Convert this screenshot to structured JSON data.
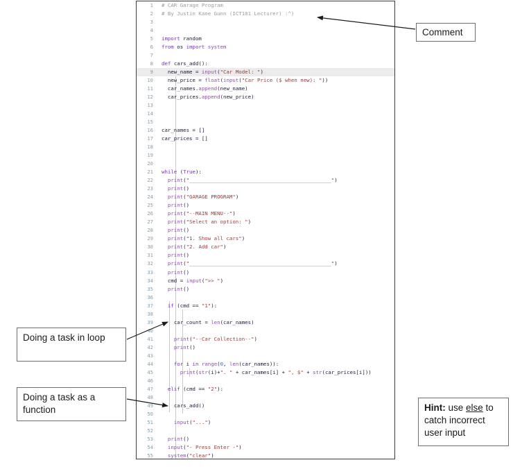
{
  "editor": {
    "name": "python-code-editor",
    "language": "Python",
    "current_line": 9,
    "lines": [
      {
        "n": 1,
        "text": "# CAR Garage Program"
      },
      {
        "n": 2,
        "text": "# By Justin Kane Gunn (ICT101 Lecturer) :^)"
      },
      {
        "n": 3,
        "text": ""
      },
      {
        "n": 4,
        "text": ""
      },
      {
        "n": 5,
        "text": "import random"
      },
      {
        "n": 6,
        "text": "from os import system"
      },
      {
        "n": 7,
        "text": ""
      },
      {
        "n": 8,
        "text": "def cars_add():"
      },
      {
        "n": 9,
        "text": "  new_name = input(\"Car Model: \")"
      },
      {
        "n": 10,
        "text": "  new_price = float(input(\"Car Price ($ when new): \"))"
      },
      {
        "n": 11,
        "text": "  car_names.append(new_name)"
      },
      {
        "n": 12,
        "text": "  car_prices.append(new_price)"
      },
      {
        "n": 13,
        "text": ""
      },
      {
        "n": 14,
        "text": ""
      },
      {
        "n": 15,
        "text": ""
      },
      {
        "n": 16,
        "text": "car_names = []"
      },
      {
        "n": 17,
        "text": "car_prices = []"
      },
      {
        "n": 18,
        "text": ""
      },
      {
        "n": 19,
        "text": ""
      },
      {
        "n": 20,
        "text": ""
      },
      {
        "n": 21,
        "text": "while (True):"
      },
      {
        "n": 22,
        "text": "  print(\"______________________________________________\")"
      },
      {
        "n": 23,
        "text": "  print()"
      },
      {
        "n": 24,
        "text": "  print(\"GARAGE PROGRAM\")"
      },
      {
        "n": 25,
        "text": "  print()"
      },
      {
        "n": 26,
        "text": "  print(\"--MAIN MENU--\")"
      },
      {
        "n": 27,
        "text": "  print(\"Select an option: \")"
      },
      {
        "n": 28,
        "text": "  print()"
      },
      {
        "n": 29,
        "text": "  print(\"1. Show all cars\")"
      },
      {
        "n": 30,
        "text": "  print(\"2. Add car\")"
      },
      {
        "n": 31,
        "text": "  print()"
      },
      {
        "n": 32,
        "text": "  print(\"______________________________________________\")"
      },
      {
        "n": 33,
        "text": "  print()"
      },
      {
        "n": 34,
        "text": "  cmd = input(\">> \")"
      },
      {
        "n": 35,
        "text": "  print()"
      },
      {
        "n": 36,
        "text": ""
      },
      {
        "n": 37,
        "text": "  if (cmd == \"1\"):"
      },
      {
        "n": 38,
        "text": ""
      },
      {
        "n": 39,
        "text": "    car_count = len(car_names)"
      },
      {
        "n": 40,
        "text": ""
      },
      {
        "n": 41,
        "text": "    print(\"--Car Collection--\")"
      },
      {
        "n": 42,
        "text": "    print()"
      },
      {
        "n": 43,
        "text": ""
      },
      {
        "n": 44,
        "text": "    for i in range(0, len(car_names)):"
      },
      {
        "n": 45,
        "text": "      print(str(i)+\". \" + car_names[i] + \", $\" + str(car_prices[i]))"
      },
      {
        "n": 46,
        "text": ""
      },
      {
        "n": 47,
        "text": "  elif (cmd == \"2\"):"
      },
      {
        "n": 48,
        "text": ""
      },
      {
        "n": 49,
        "text": "    cars_add()"
      },
      {
        "n": 50,
        "text": ""
      },
      {
        "n": 51,
        "text": "    input(\"...\")"
      },
      {
        "n": 52,
        "text": ""
      },
      {
        "n": 53,
        "text": "  print()"
      },
      {
        "n": 54,
        "text": "  input(\"- Press Enter -\")"
      },
      {
        "n": 55,
        "text": "  system(\"clear\")"
      }
    ]
  },
  "annotations": {
    "comment": {
      "label": "Comment",
      "target_line": 2
    },
    "loop": {
      "label": "Doing a task in loop",
      "target_line": 39
    },
    "function": {
      "label": "Doing a task as a function",
      "target_line": 49
    },
    "hint": {
      "prefix": "Hint:",
      "middle_before": " use ",
      "keyword": "else",
      "middle_after": " to catch incorrect user input"
    }
  },
  "colors": {
    "comment": "#9b9b9b",
    "keyword": "#7b2fbe",
    "builtin": "#8f4fa8",
    "string": "#9c3a38",
    "number": "#3a6fa8",
    "gutter": "#7f9fb0",
    "current_line_bg": "#ebebeb",
    "panel_border": "#3c3c3c",
    "box_border": "#6e6e6e"
  }
}
